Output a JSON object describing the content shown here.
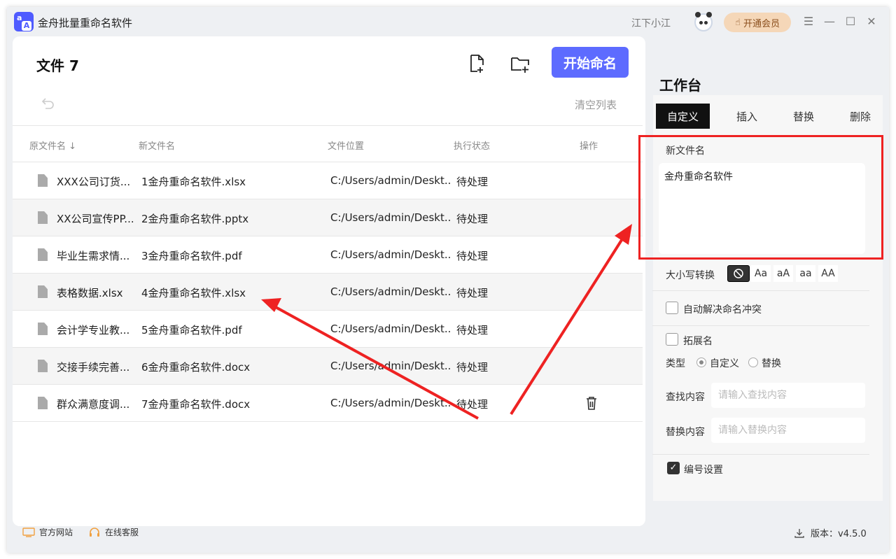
{
  "app": {
    "title": "金舟批量重命名软件"
  },
  "header": {
    "user_name": "江下小江",
    "vip_label": "开通会员",
    "min_glyph": "—",
    "max_glyph": "☐",
    "close_glyph": "✕",
    "menu_glyph": "☰"
  },
  "file_panel": {
    "title": "文件 7",
    "start_label": "开始命名",
    "clear_label": "清空列表",
    "columns": [
      "原文件名 ↓",
      "新文件名",
      "文件位置",
      "执行状态",
      "操作"
    ],
    "rows": [
      {
        "original": "XXX公司订货...",
        "new_name": "1金舟重命名软件.xlsx",
        "location": "C:/Users/admin/Deskt...",
        "status": "待处理"
      },
      {
        "original": "XX公司宣传PP...",
        "new_name": "2金舟重命名软件.pptx",
        "location": "C:/Users/admin/Deskt...",
        "status": "待处理"
      },
      {
        "original": "毕业生需求情...",
        "new_name": "3金舟重命名软件.pdf",
        "location": "C:/Users/admin/Deskt...",
        "status": "待处理"
      },
      {
        "original": "表格数据.xlsx",
        "new_name": "4金舟重命名软件.xlsx",
        "location": "C:/Users/admin/Deskt...",
        "status": "待处理"
      },
      {
        "original": "会计学专业教...",
        "new_name": "5金舟重命名软件.pdf",
        "location": "C:/Users/admin/Deskt...",
        "status": "待处理"
      },
      {
        "original": "交接手续完善...",
        "new_name": "6金舟重命名软件.docx",
        "location": "C:/Users/admin/Deskt...",
        "status": "待处理"
      },
      {
        "original": "群众满意度调...",
        "new_name": "7金舟重命名软件.docx",
        "location": "C:/Users/admin/Deskt...",
        "status": "待处理"
      }
    ]
  },
  "workbench": {
    "title": "工作台",
    "tabs": [
      "自定义",
      "插入",
      "替换",
      "删除"
    ],
    "new_name_label": "新文件名",
    "new_name_value": "金舟重命名软件",
    "case_label": "大小写转换",
    "case_options": [
      "Aa",
      "aA",
      "aa",
      "AA"
    ],
    "auto_resolve_label": "自动解决命名冲突",
    "extension_label": "拓展名",
    "type_label": "类型",
    "type_options": [
      "自定义",
      "替换"
    ],
    "find_label": "查找内容",
    "find_placeholder": "请输入查找内容",
    "replace_label": "替换内容",
    "replace_placeholder": "请输入替换内容",
    "numbering_label": "编号设置"
  },
  "footer": {
    "website": "官方网站",
    "support": "在线客服",
    "version": "版本：v4.5.0"
  },
  "colors": {
    "accent": "#5d6bff",
    "annotation": "#ee2222",
    "vip_bg": "#f5d7b8"
  }
}
